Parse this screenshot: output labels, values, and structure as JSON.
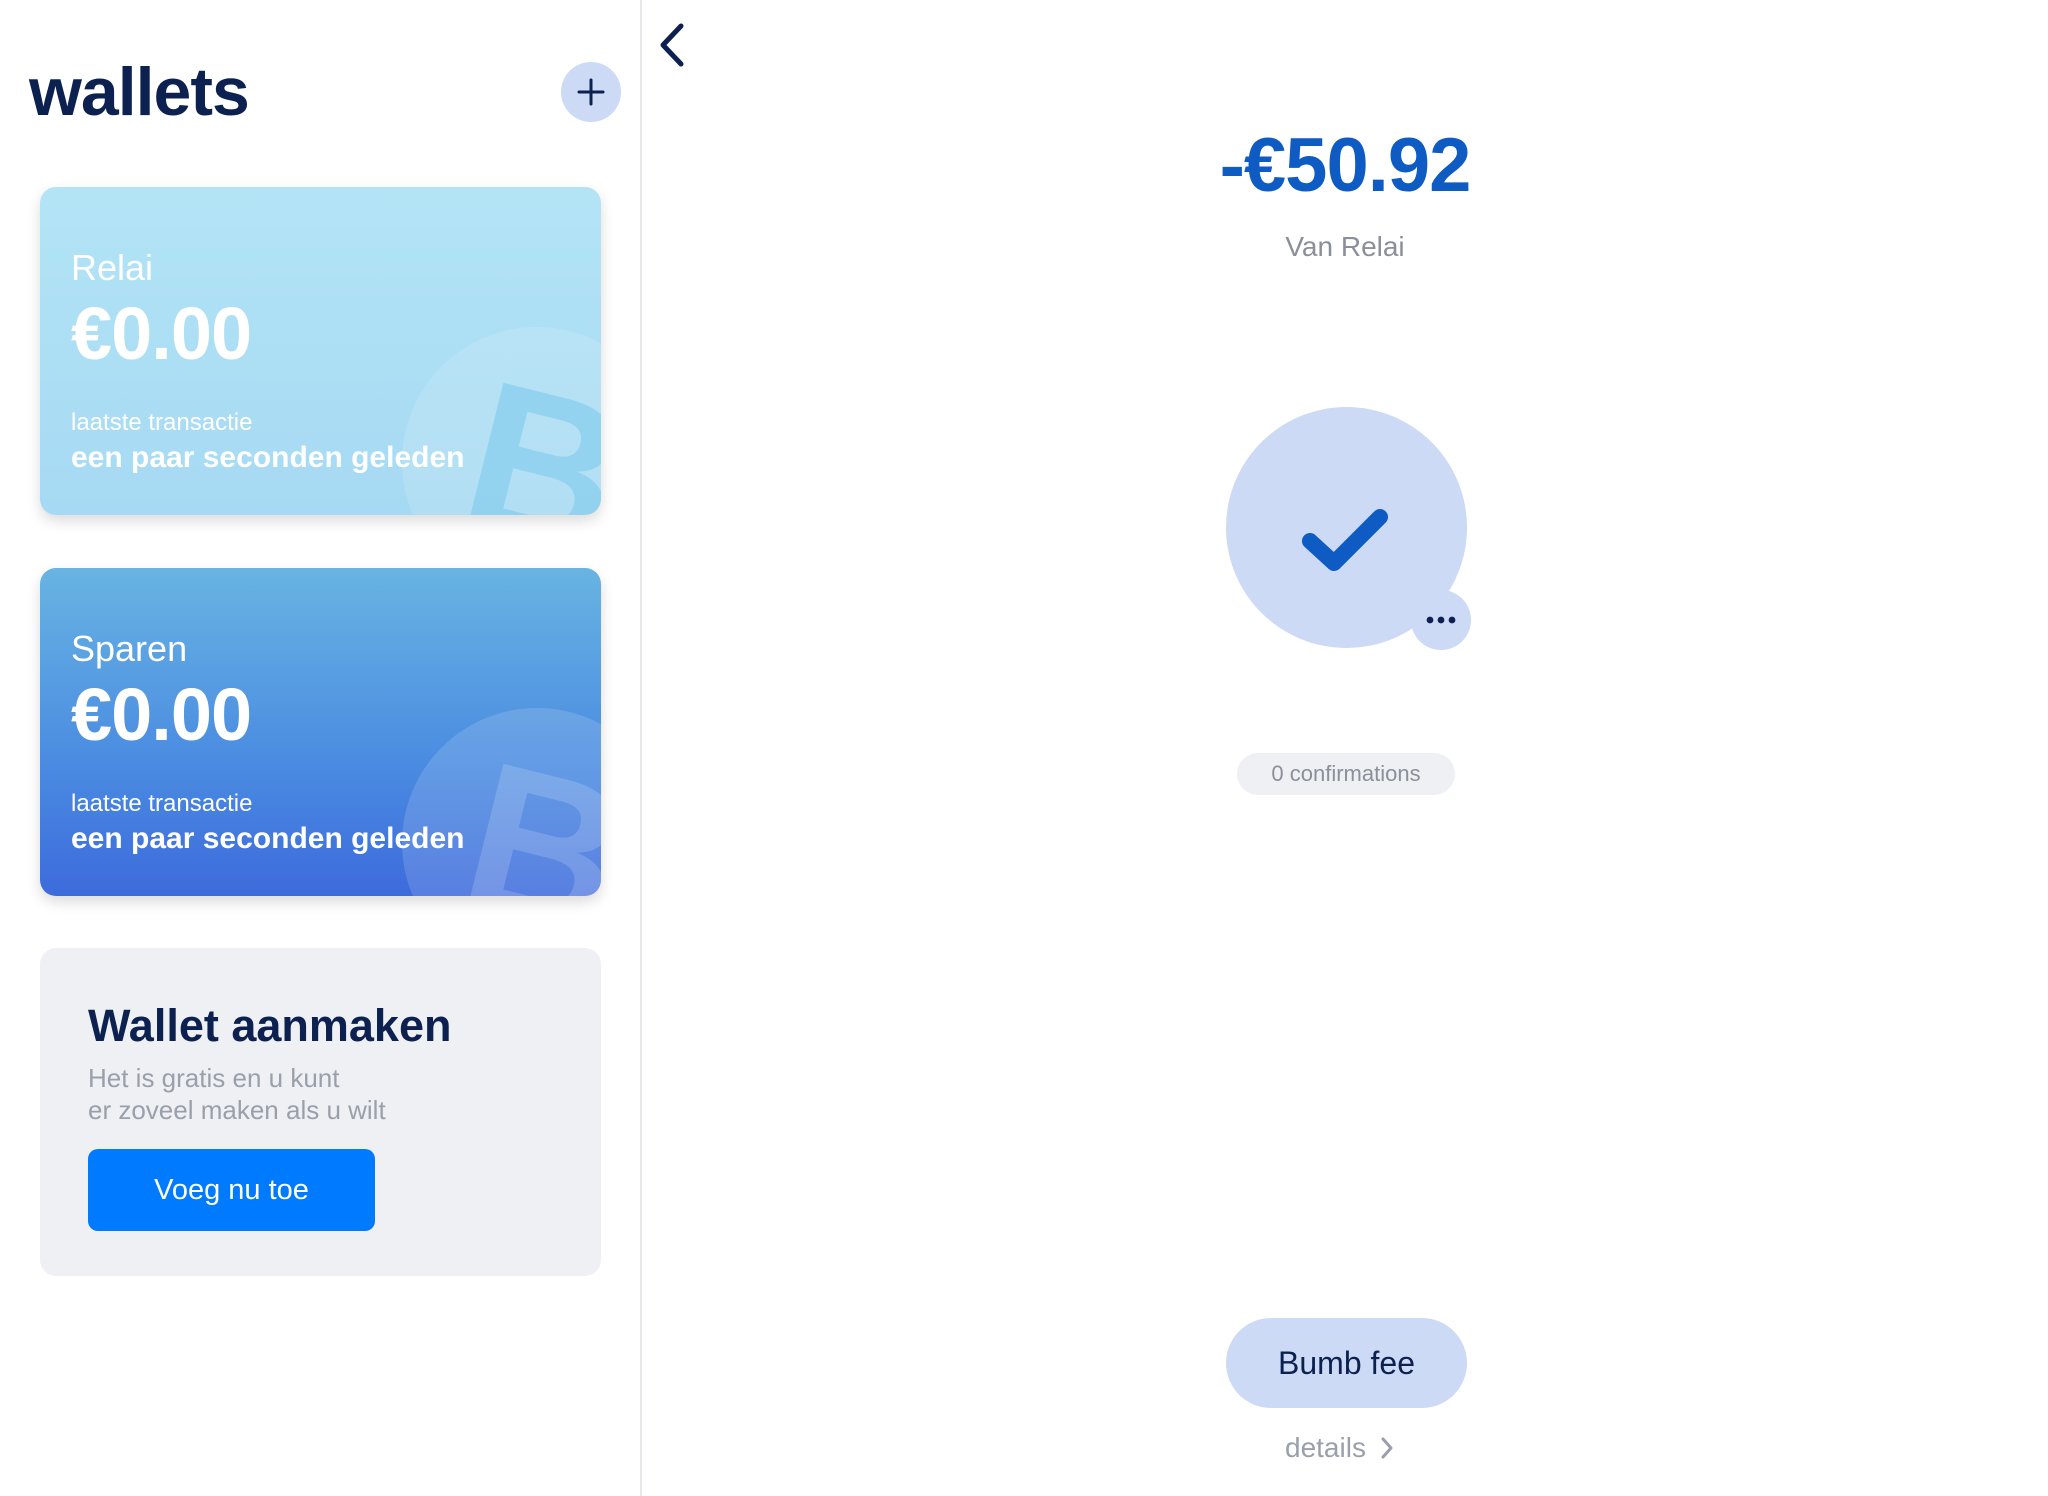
{
  "sidebar": {
    "title": "wallets",
    "add_icon": "plus-icon",
    "wallets": [
      {
        "name": "Relai",
        "balance": "€0.00",
        "caption": "laatste transactie",
        "time": "een paar seconden geleden",
        "bg": "#b3e4f6"
      },
      {
        "name": "Sparen",
        "balance": "€0.00",
        "caption": "laatste transactie",
        "time": "een paar seconden geleden",
        "bg": "#4a8be1"
      }
    ],
    "create": {
      "title": "Wallet aanmaken",
      "desc_line1": "Het is gratis en u kunt",
      "desc_line2": "er zoveel maken als u wilt",
      "button_label": "Voeg nu toe"
    }
  },
  "transaction": {
    "back_icon": "chevron-left-icon",
    "amount": "-€50.92",
    "from": "Van Relai",
    "status_icon": "checkmark-icon",
    "pending_icon": "more-dots-icon",
    "confirmations": "0 confirmations",
    "bump_label": "Bumb fee",
    "details_label": "details",
    "details_icon": "chevron-right-icon"
  },
  "colors": {
    "primary_text": "#0c2150",
    "amount": "#0e5bc4",
    "accent_button": "#007aff",
    "soft_blue": "#cddaf6",
    "muted": "#8a8f99"
  }
}
